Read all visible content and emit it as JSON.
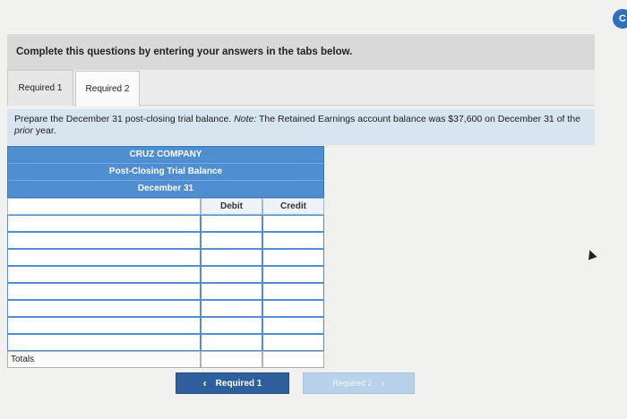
{
  "corner_badge": "C",
  "instructions": "Complete this questions by entering your answers in the tabs below.",
  "tabs": [
    {
      "label": "Required 1"
    },
    {
      "label": "Required 2"
    }
  ],
  "prompt": {
    "text_main": "Prepare the December 31 post-closing trial balance. ",
    "note_label": "Note:",
    "text_note": " The Retained Earnings account balance was $37,600 on December 31 of the ",
    "italic": "prior",
    "text_end": " year."
  },
  "trial_balance": {
    "company": "CRUZ COMPANY",
    "statement": "Post-Closing Trial Balance",
    "date": "December 31",
    "col_debit": "Debit",
    "col_credit": "Credit",
    "totals_label": "Totals"
  },
  "nav": {
    "prev_label": "Required 1",
    "next_label": "Required 2"
  }
}
